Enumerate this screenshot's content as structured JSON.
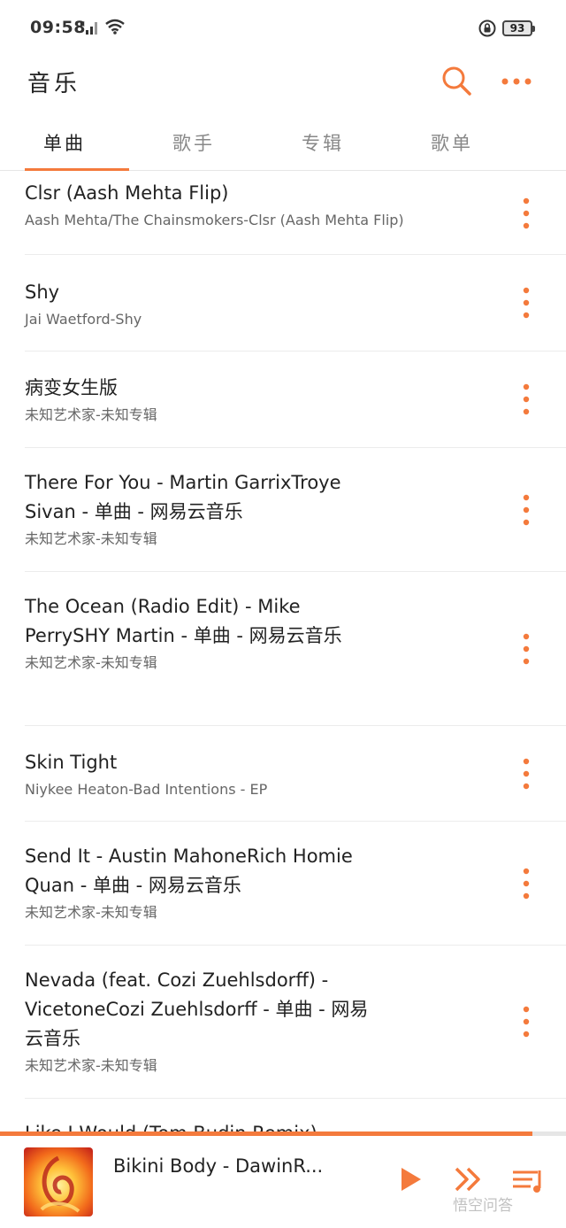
{
  "status_bar": {
    "time": "09:58",
    "battery": "93"
  },
  "header": {
    "title": "音乐"
  },
  "tabs": [
    "单曲",
    "歌手",
    "专辑",
    "歌单"
  ],
  "songs": [
    {
      "name": "Clsr (Aash Mehta Flip)",
      "artist": "Aash Mehta/The Chainsmokers-Clsr (Aash Mehta Flip)"
    },
    {
      "name": "Shy",
      "artist": "Jai Waetford-Shy"
    },
    {
      "name": "病变女生版",
      "artist": "未知艺术家-未知专辑"
    },
    {
      "name": "There For You - Martin GarrixTroye Sivan - 单曲 - 网易云音乐",
      "artist": "未知艺术家-未知专辑"
    },
    {
      "name": "The Ocean (Radio Edit) - Mike PerrySHY Martin - 单曲 - 网易云音乐",
      "artist": "未知艺术家-未知专辑"
    },
    {
      "name": "Skin Tight",
      "artist": "Niykee Heaton-Bad Intentions - EP"
    },
    {
      "name": "Send It - Austin MahoneRich Homie Quan - 单曲 - 网易云音乐",
      "artist": "未知艺术家-未知专辑"
    },
    {
      "name": "Nevada (feat. Cozi Zuehlsdorff) - VicetoneCozi Zuehlsdorff - 单曲 - 网易云音乐",
      "artist": "未知艺术家-未知专辑"
    },
    {
      "name": "Like I Would (Tom Budin Remix)",
      "artist": ""
    }
  ],
  "player": {
    "title": "Bikini Body - DawinR...",
    "progress": 0.94
  },
  "watermark": "悟空问答",
  "colors": {
    "accent": "#f47a3c"
  }
}
